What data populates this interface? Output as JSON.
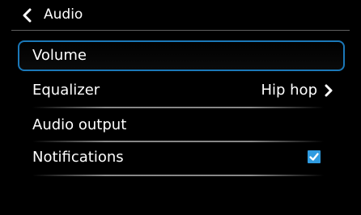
{
  "header": {
    "title": "Audio",
    "back_icon": "chevron-left-icon"
  },
  "menu": {
    "items": [
      {
        "label": "Volume",
        "selected": true
      },
      {
        "label": "Equalizer",
        "value": "Hip hop",
        "trailing_icon": "chevron-right-icon"
      },
      {
        "label": "Audio output"
      },
      {
        "label": "Notifications",
        "checked": true
      }
    ]
  },
  "colors": {
    "background": "#000000",
    "text": "#ffffff",
    "focus_border": "#1b78b8",
    "checkbox": "#2f9be0"
  }
}
